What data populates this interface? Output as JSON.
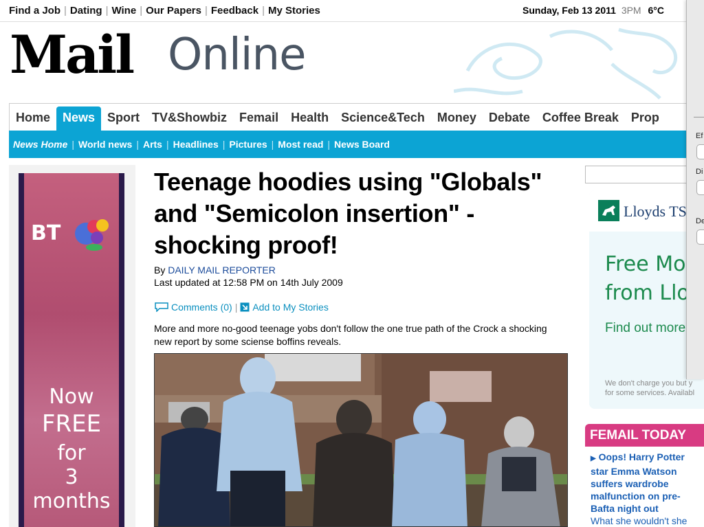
{
  "topbar": {
    "links": [
      "Find a Job",
      "Dating",
      "Wine",
      "Our Papers",
      "Feedback",
      "My Stories"
    ],
    "date": "Sunday, Feb 13 2011",
    "time": "3PM",
    "temp": "6°C"
  },
  "logo": {
    "mail": "Mail",
    "online": "Online"
  },
  "mainnav": [
    "Home",
    "News",
    "Sport",
    "TV&Showbiz",
    "Femail",
    "Health",
    "Science&Tech",
    "Money",
    "Debate",
    "Coffee Break",
    "Prop"
  ],
  "mainnav_active": "News",
  "subnav": [
    "News Home",
    "World news",
    "Arts",
    "Headlines",
    "Pictures",
    "Most read",
    "News Board"
  ],
  "leftad": {
    "brand": "BT",
    "line1": "Now",
    "line2": "FREE",
    "line3": "for",
    "line4": "3 months"
  },
  "article": {
    "headline": "Teenage hoodies using \"Globals\" and \"Semicolon insertion\" - shocking proof!",
    "by_prefix": "By ",
    "author": "DAILY MAIL REPORTER",
    "updated": "Last updated at 12:58 PM on 14th July 2009",
    "comments": "Comments (0)",
    "add_to_stories": "Add to My Stories",
    "summary": "More and more no-good teenage yobs don't follow the one true path of the Crock a shocking new report by some sciense boffins reveals."
  },
  "lloyds_ad": {
    "brand": "Lloyds TS",
    "line1": "Free Mo",
    "line2": "from Lloy",
    "cta": "Find out more",
    "fine1": "We don't charge you but y",
    "fine2": "for some services. Availabl"
  },
  "femail": {
    "header": "FEMAIL TODAY",
    "story": "Oops! Harry Potter star Emma Watson suffers wardrobe malfunction on pre-Bafta night out",
    "story_more": "What she wouldn't she"
  },
  "sheet": {
    "labels": [
      "Ef",
      "Di",
      "De"
    ]
  }
}
